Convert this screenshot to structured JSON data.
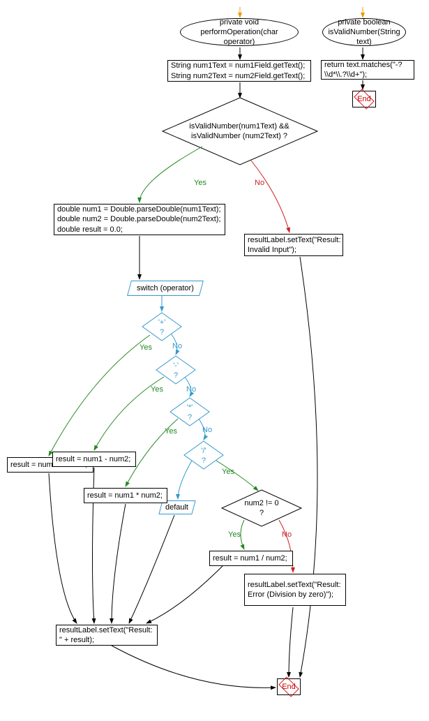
{
  "flowchart": {
    "nodes": {
      "start1": "private void performOperation(char operator)",
      "start2": "private boolean isValidNumber(String text)",
      "stmt_getText": "String num1Text = num1Field.getText();\nString num2Text = num2Field.getText();",
      "stmt_matches": "return text.matches(\"-?\\\\d*\\\\.?\\\\d+\");",
      "decision_valid": "isValidNumber(num1Text) && isValidNumber (num2Text) ?",
      "stmt_parse": "double num1 = Double.parseDouble(num1Text);\ndouble num2 = Double.parseDouble(num2Text);\ndouble result = 0.0;",
      "stmt_invalid": "resultLabel.setText(\"Result: Invalid Input\");",
      "switch_op": "switch (operator)",
      "case_plus": "'+' ?",
      "case_minus": "'-' ?",
      "case_star": "'*' ?",
      "case_slash": "'/' ?",
      "default": "default",
      "stmt_add": "result = num1 + num2;",
      "stmt_sub": "result = num1 - num2;",
      "stmt_mul": "result = num1 * num2;",
      "decision_zero": "num2 != 0 ?",
      "stmt_div": "result = num1 / num2;",
      "stmt_divzero": "resultLabel.setText(\"Result: Error (Division by zero)\");",
      "stmt_result": "resultLabel.setText(\"Result: \" + result);",
      "end": "End"
    },
    "labels": {
      "yes": "Yes",
      "no": "No"
    }
  }
}
